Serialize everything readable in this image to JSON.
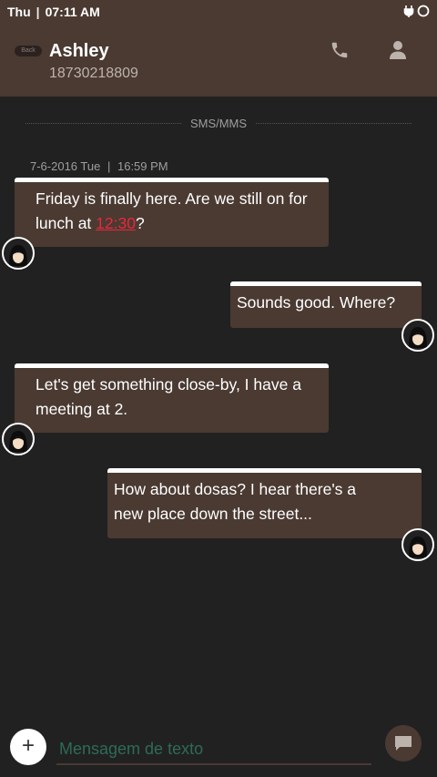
{
  "status_bar": {
    "day": "Thu",
    "time": "07:11 AM",
    "icons": [
      "usb-icon",
      "ring-icon"
    ]
  },
  "header": {
    "back_label": "Back",
    "contact_name": "Ashley",
    "contact_number": "18730218809",
    "actions": [
      "call-icon",
      "contact-icon"
    ]
  },
  "thread": {
    "type_label": "SMS/MMS",
    "timestamp_date": "7-6-2016 Tue",
    "timestamp_time": "16:59 PM"
  },
  "messages": [
    {
      "direction": "incoming",
      "line1": "Friday is finally here. Are we still on for",
      "line2_prefix": "lunch at ",
      "line2_link": "12:30",
      "line2_suffix": "?"
    },
    {
      "direction": "outgoing",
      "line1": "Sounds good. Where?"
    },
    {
      "direction": "incoming",
      "line1": "Let's get something close-by, I have a",
      "line2": "meeting at 2."
    },
    {
      "direction": "outgoing",
      "line1": "How about dosas? I hear there's a",
      "line2": "new place down the street..."
    }
  ],
  "composer": {
    "add_label": "+",
    "placeholder": "Mensagem de texto",
    "value": ""
  },
  "colors": {
    "header_bg": "#4a3a32",
    "bubble_bg": "#4a3a32",
    "page_bg": "#212121",
    "link": "#e8283c",
    "placeholder": "#2e6b57"
  }
}
